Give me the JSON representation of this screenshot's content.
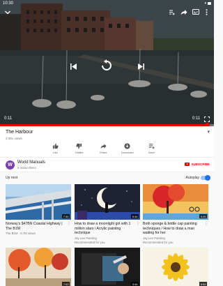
{
  "status_bar": {
    "time": "10:30"
  },
  "player": {
    "current_time": "0:11",
    "remaining_time": "0:11",
    "progress_fraction": 0.97
  },
  "video": {
    "title": "The Harbour",
    "views": "2,491 views"
  },
  "actions": [
    {
      "label": "Like",
      "icon": "thumbs-up-icon"
    },
    {
      "label": "Dislike",
      "icon": "thumbs-down-icon"
    },
    {
      "label": "Share",
      "icon": "share-icon"
    },
    {
      "label": "Download",
      "icon": "download-icon"
    },
    {
      "label": "Save",
      "icon": "add-to-playlist-icon"
    }
  ],
  "channel": {
    "avatar_letter": "W",
    "name": "World Manuals",
    "subscribers": "5 subscribers",
    "subscribe_label": "SUBSCRIBE"
  },
  "up_next": {
    "label": "Up next",
    "autoplay_label": "Autoplay",
    "autoplay_on": true
  },
  "recommendations": [
    {
      "title": "Norway's $47BN Coastal Highway | The B1M",
      "meta": "The B1M · 8.7M views",
      "meta2": "",
      "duration": "7:30"
    },
    {
      "title": "How to draw a moonlight girl with 1 million stars / Acrylic painting technique",
      "meta": "Jay Lee Painting",
      "meta2": "Recommended for you",
      "duration": "5:44"
    },
    {
      "title": "Both sponge & bottle cap painting techniques / How to draw a man waiting for her",
      "meta": "Jay Lee Painting",
      "meta2": "Recommended for you",
      "duration": "5:26"
    },
    {
      "title": "",
      "meta": "",
      "meta2": "",
      "duration": "7:03"
    },
    {
      "title": "",
      "meta": "",
      "meta2": "",
      "duration": "3:44"
    },
    {
      "title": "",
      "meta": "",
      "meta2": "",
      "duration": "6:54"
    }
  ],
  "colors": {
    "accent_red": "#ee0000",
    "autoplay_blue": "#1e73e8",
    "avatar_purple": "#7b3fb0"
  }
}
